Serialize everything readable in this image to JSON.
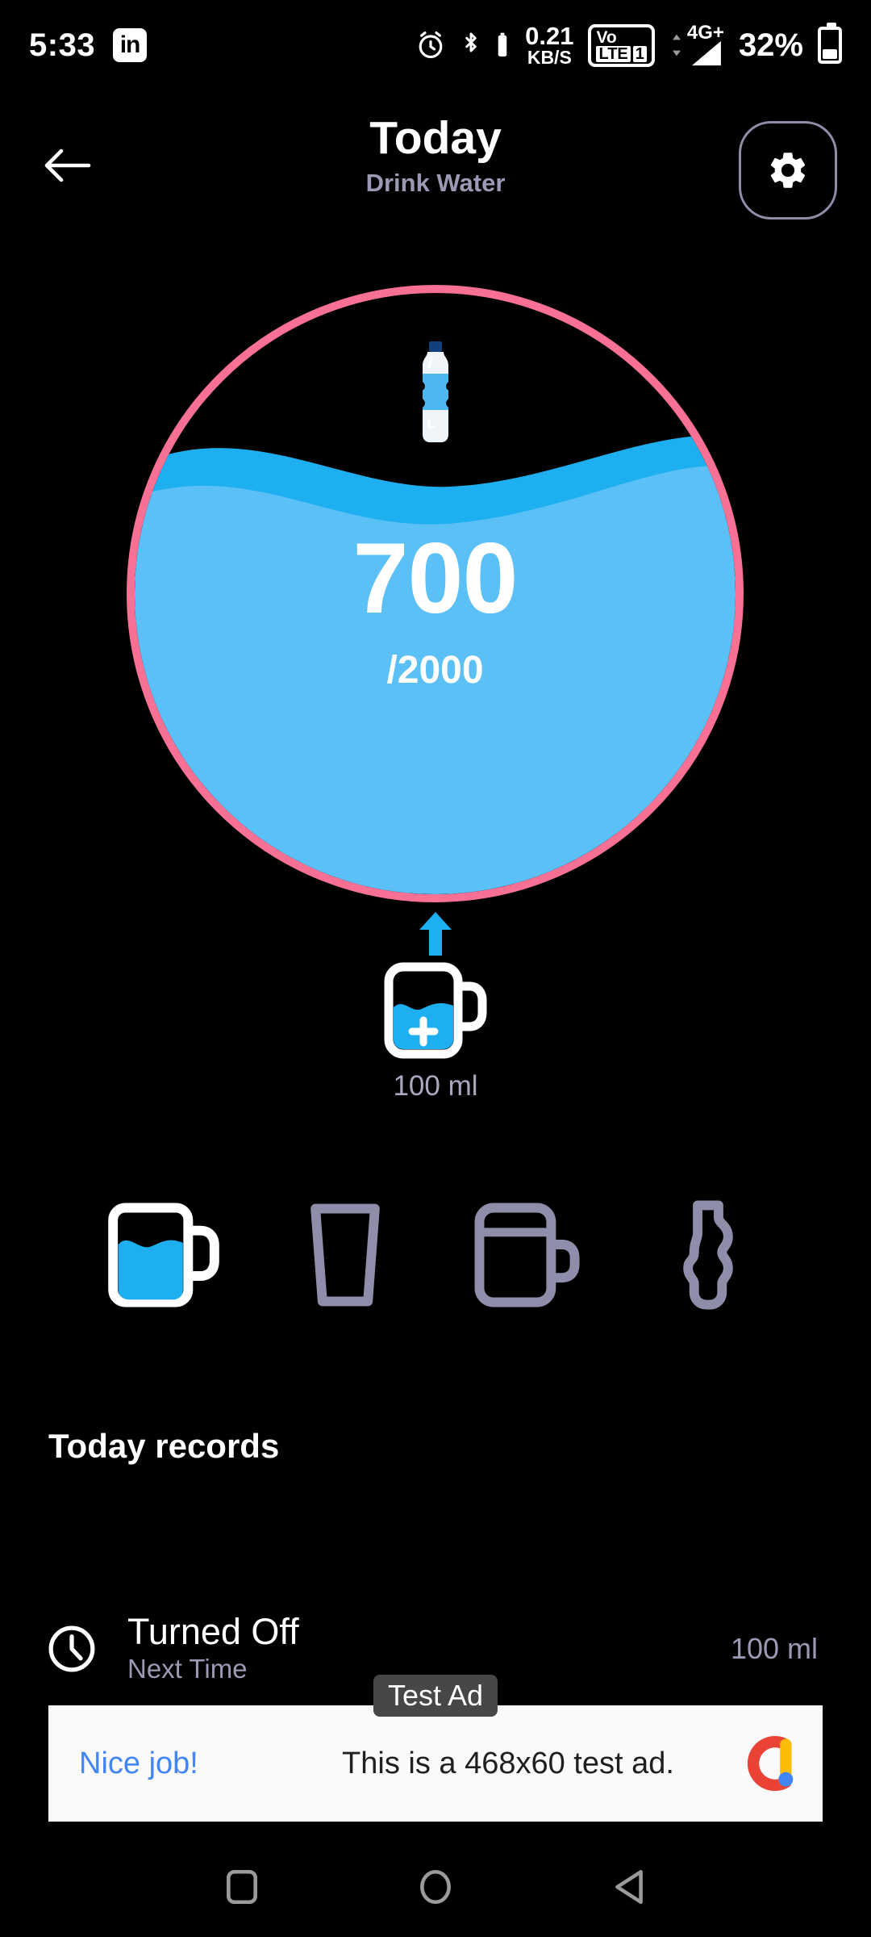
{
  "status_bar": {
    "time": "5:33",
    "notification_icon": "linkedin-icon",
    "linkedin_label": "in",
    "alarm_icon": "alarm-icon",
    "bluetooth_icon": "bluetooth-icon",
    "bluetooth_battery_icon": "bluetooth-battery-icon",
    "data_rate_value": "0.21",
    "data_rate_unit": "KB/S",
    "volte_top": "Vo",
    "volte_bottom": "LTE",
    "sim_slot": "1",
    "network_type": "4G+",
    "battery_percent": "32%",
    "battery_icon": "battery-icon"
  },
  "header": {
    "back_icon": "back-arrow-icon",
    "title": "Today",
    "subtitle": "Drink Water",
    "settings_icon": "gear-icon"
  },
  "progress": {
    "bottle_icon": "water-bottle-icon",
    "current": "700",
    "goal": "/2000",
    "goal_value": 2000,
    "current_value": 700,
    "ring_color": "#f87195",
    "water_color": "#5bc0f5",
    "water_back_color": "#1eaff0",
    "fill_percent": 55
  },
  "add_button": {
    "up_arrow_icon": "up-arrow-icon",
    "mug_icon": "mug-plus-icon",
    "plus_label": "+",
    "amount_label": "100 ml"
  },
  "containers": [
    {
      "name": "mug",
      "icon": "mug-icon",
      "selected": true
    },
    {
      "name": "glass",
      "icon": "glass-icon",
      "selected": false
    },
    {
      "name": "tumbler",
      "icon": "tumbler-icon",
      "selected": false
    },
    {
      "name": "bottle",
      "icon": "bottle-icon",
      "selected": false
    }
  ],
  "records": {
    "section_title": "Today records",
    "items": [
      {
        "icon": "clock-icon",
        "title": "Turned Off",
        "subtitle": "Next Time",
        "amount": "100 ml"
      }
    ]
  },
  "ad": {
    "badge": "Test Ad",
    "cta": "Nice job!",
    "body": "This is a 468x60 test ad.",
    "logo_icon": "admob-logo-icon"
  },
  "nav_bar": {
    "recents_icon": "square-recents-icon",
    "home_icon": "circle-home-icon",
    "back_icon": "triangle-back-icon"
  }
}
